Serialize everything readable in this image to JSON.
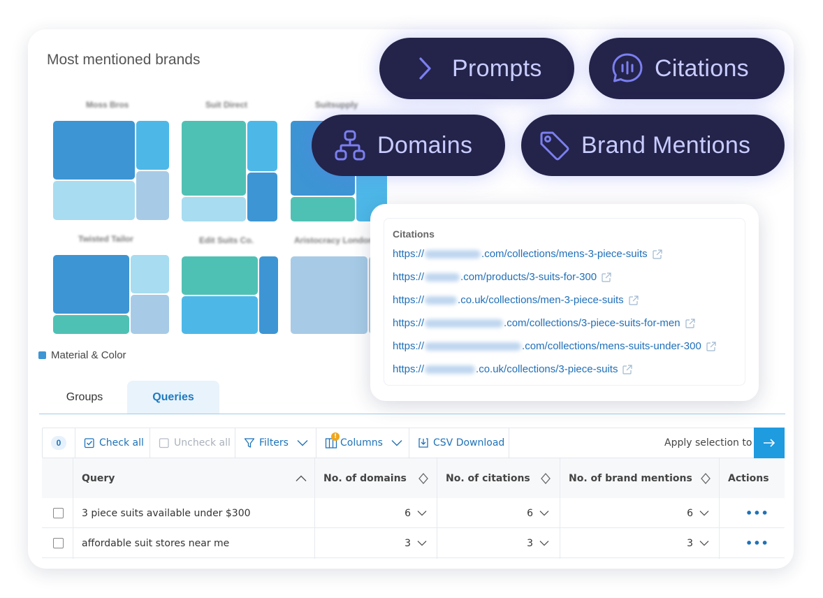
{
  "treemap": {
    "title": "Most mentioned brands",
    "brands": [
      "Moss Bros",
      "Suit Direct",
      "Suitsupply",
      "Twisted Tailor",
      "Edit Suits Co.",
      "Aristocracy London"
    ],
    "legend_label": "Material & Color",
    "colors": {
      "blue": "#3d95d4",
      "sky": "#4db8e8",
      "teal": "#4fc1b4",
      "pale": "#a8dcf0",
      "steel": "#a7cbe6"
    }
  },
  "pills": {
    "prompts": "Prompts",
    "citations": "Citations",
    "domains": "Domains",
    "brand_mentions": "Brand Mentions"
  },
  "citations": {
    "title": "Citations",
    "links": [
      {
        "prefix": "https://",
        "suffix": ".com/collections/mens-3-piece-suits"
      },
      {
        "prefix": "https://",
        "suffix": ".com/products/3-suits-for-300"
      },
      {
        "prefix": "https://",
        "suffix": ".co.uk/collections/men-3-piece-suits"
      },
      {
        "prefix": "https://",
        "suffix": ".com/collections/3-piece-suits-for-men"
      },
      {
        "prefix": "https://",
        "suffix": ".com/collections/mens-suits-under-300"
      },
      {
        "prefix": "https://",
        "suffix": ".co.uk/collections/3-piece-suits"
      }
    ]
  },
  "tabs": {
    "groups": "Groups",
    "queries": "Queries"
  },
  "toolbar": {
    "count": "0",
    "check_all": "Check all",
    "uncheck_all": "Uncheck all",
    "filters": "Filters",
    "columns": "Columns",
    "csv_download": "CSV Download",
    "apply_selection": "Apply selection to"
  },
  "table": {
    "headers": {
      "query": "Query",
      "domains": "No. of domains",
      "citations": "No. of citations",
      "brand_mentions": "No. of brand mentions",
      "actions": "Actions"
    },
    "rows": [
      {
        "query": "3 piece suits available under $300",
        "domains": "6",
        "citations": "6",
        "brand_mentions": "6",
        "actions": "•••"
      },
      {
        "query": "affordable suit stores near me",
        "domains": "3",
        "citations": "3",
        "brand_mentions": "3",
        "actions": "•••"
      }
    ]
  },
  "accent": "#1f9be0",
  "pill_bg": "#24234a"
}
